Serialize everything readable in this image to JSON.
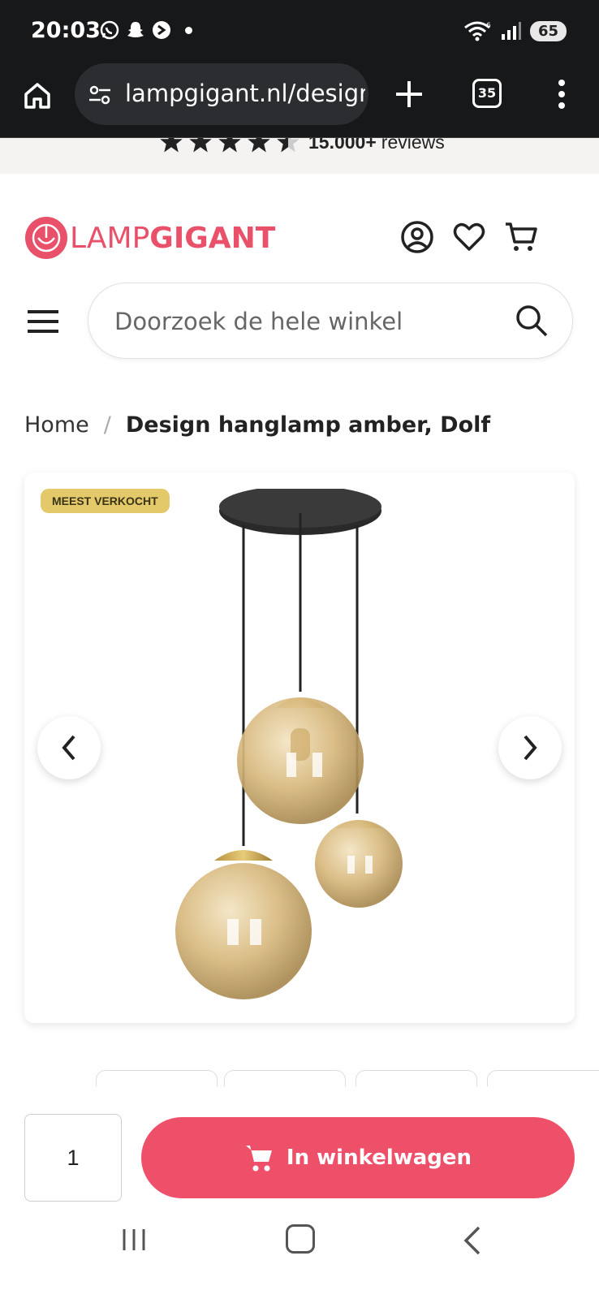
{
  "status_bar": {
    "time": "20:03",
    "notification_icons": [
      "whatsapp-icon",
      "snapchat-icon",
      "app-icon"
    ],
    "battery": "65",
    "network_label": "6"
  },
  "browser": {
    "url": "lampgigant.nl/design-hanglamp-amber-dolf",
    "tab_count": "35"
  },
  "reviews": {
    "rating_stars": 4.5,
    "count": "15.000+",
    "label": "reviews"
  },
  "header": {
    "logo_part1": "LAMP",
    "logo_part2": "GIGANT",
    "brand_color": "#e9506a"
  },
  "search": {
    "placeholder": "Doorzoek de hele winkel"
  },
  "breadcrumb": {
    "home": "Home",
    "separator": "/",
    "current": "Design hanglamp amber, Dolf"
  },
  "product": {
    "badge": "MEEST VERKOCHT",
    "badge_color": "#e3c96a",
    "image_icon": "pendant-lamp-image"
  },
  "cart": {
    "quantity": "1",
    "button_label": "In winkelwagen",
    "button_color": "#ee506a"
  }
}
